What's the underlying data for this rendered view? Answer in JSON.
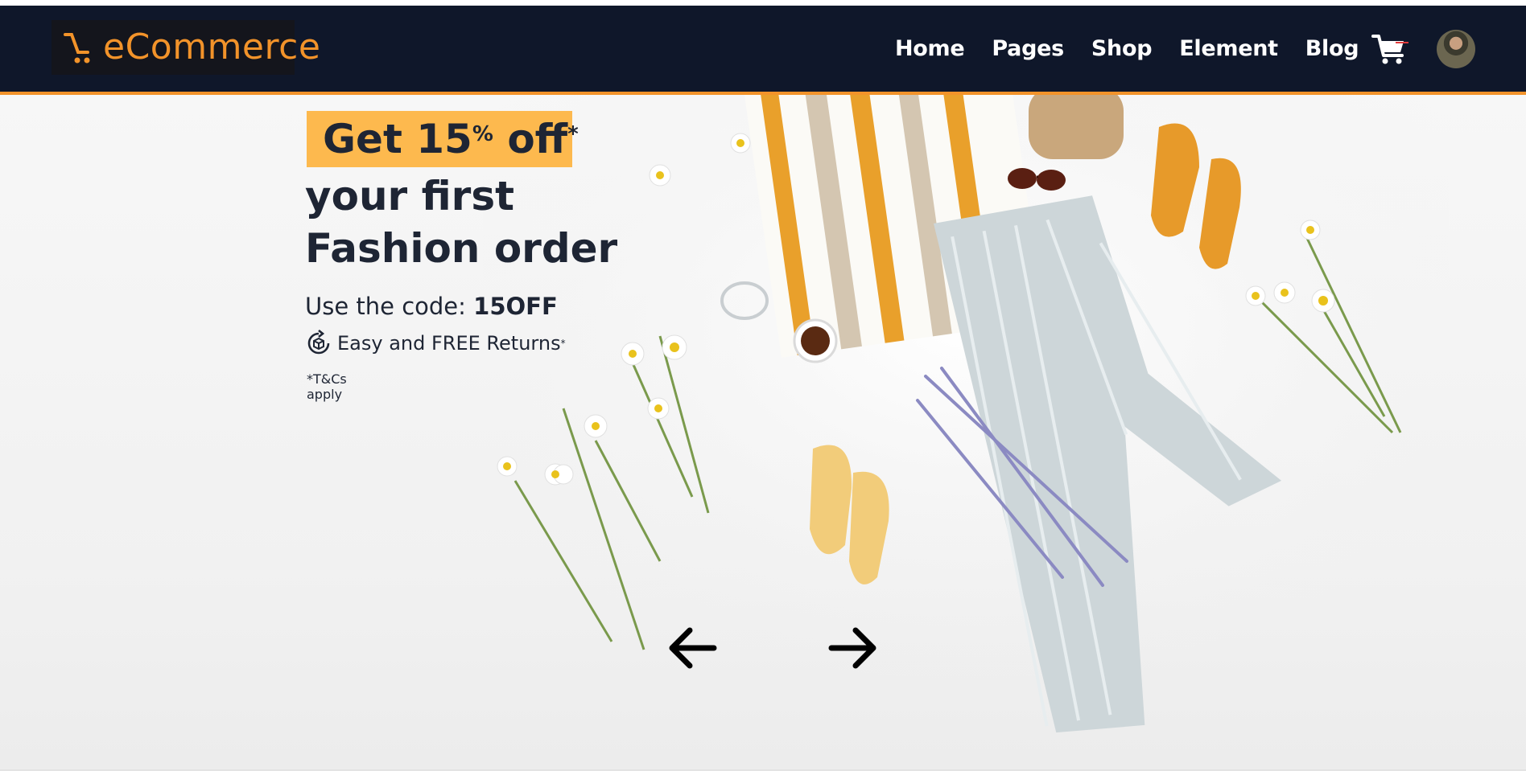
{
  "brand": {
    "logo_text": "eCommerce",
    "accent": "#f2932a",
    "nav_bg": "#0f172a"
  },
  "nav": {
    "links": [
      "Home",
      "Pages",
      "Shop",
      "Element",
      "Blog"
    ],
    "cart_icon": "cart-icon",
    "avatar": "user-avatar"
  },
  "hero": {
    "offer_prefix": "Get 15",
    "offer_pct": "%",
    "offer_suffix": " off",
    "offer_star": "*",
    "line2": "your first",
    "line3": "Fashion order",
    "code_label": "Use the code: ",
    "code": "15OFF",
    "returns_icon": "returns-icon",
    "returns": "Easy and FREE Returns",
    "returns_star": "*",
    "terms": "*T&Cs apply",
    "badge_color": "#fdb94e"
  },
  "carousel": {
    "prev_icon": "arrow-left-icon",
    "next_icon": "arrow-right-icon"
  }
}
